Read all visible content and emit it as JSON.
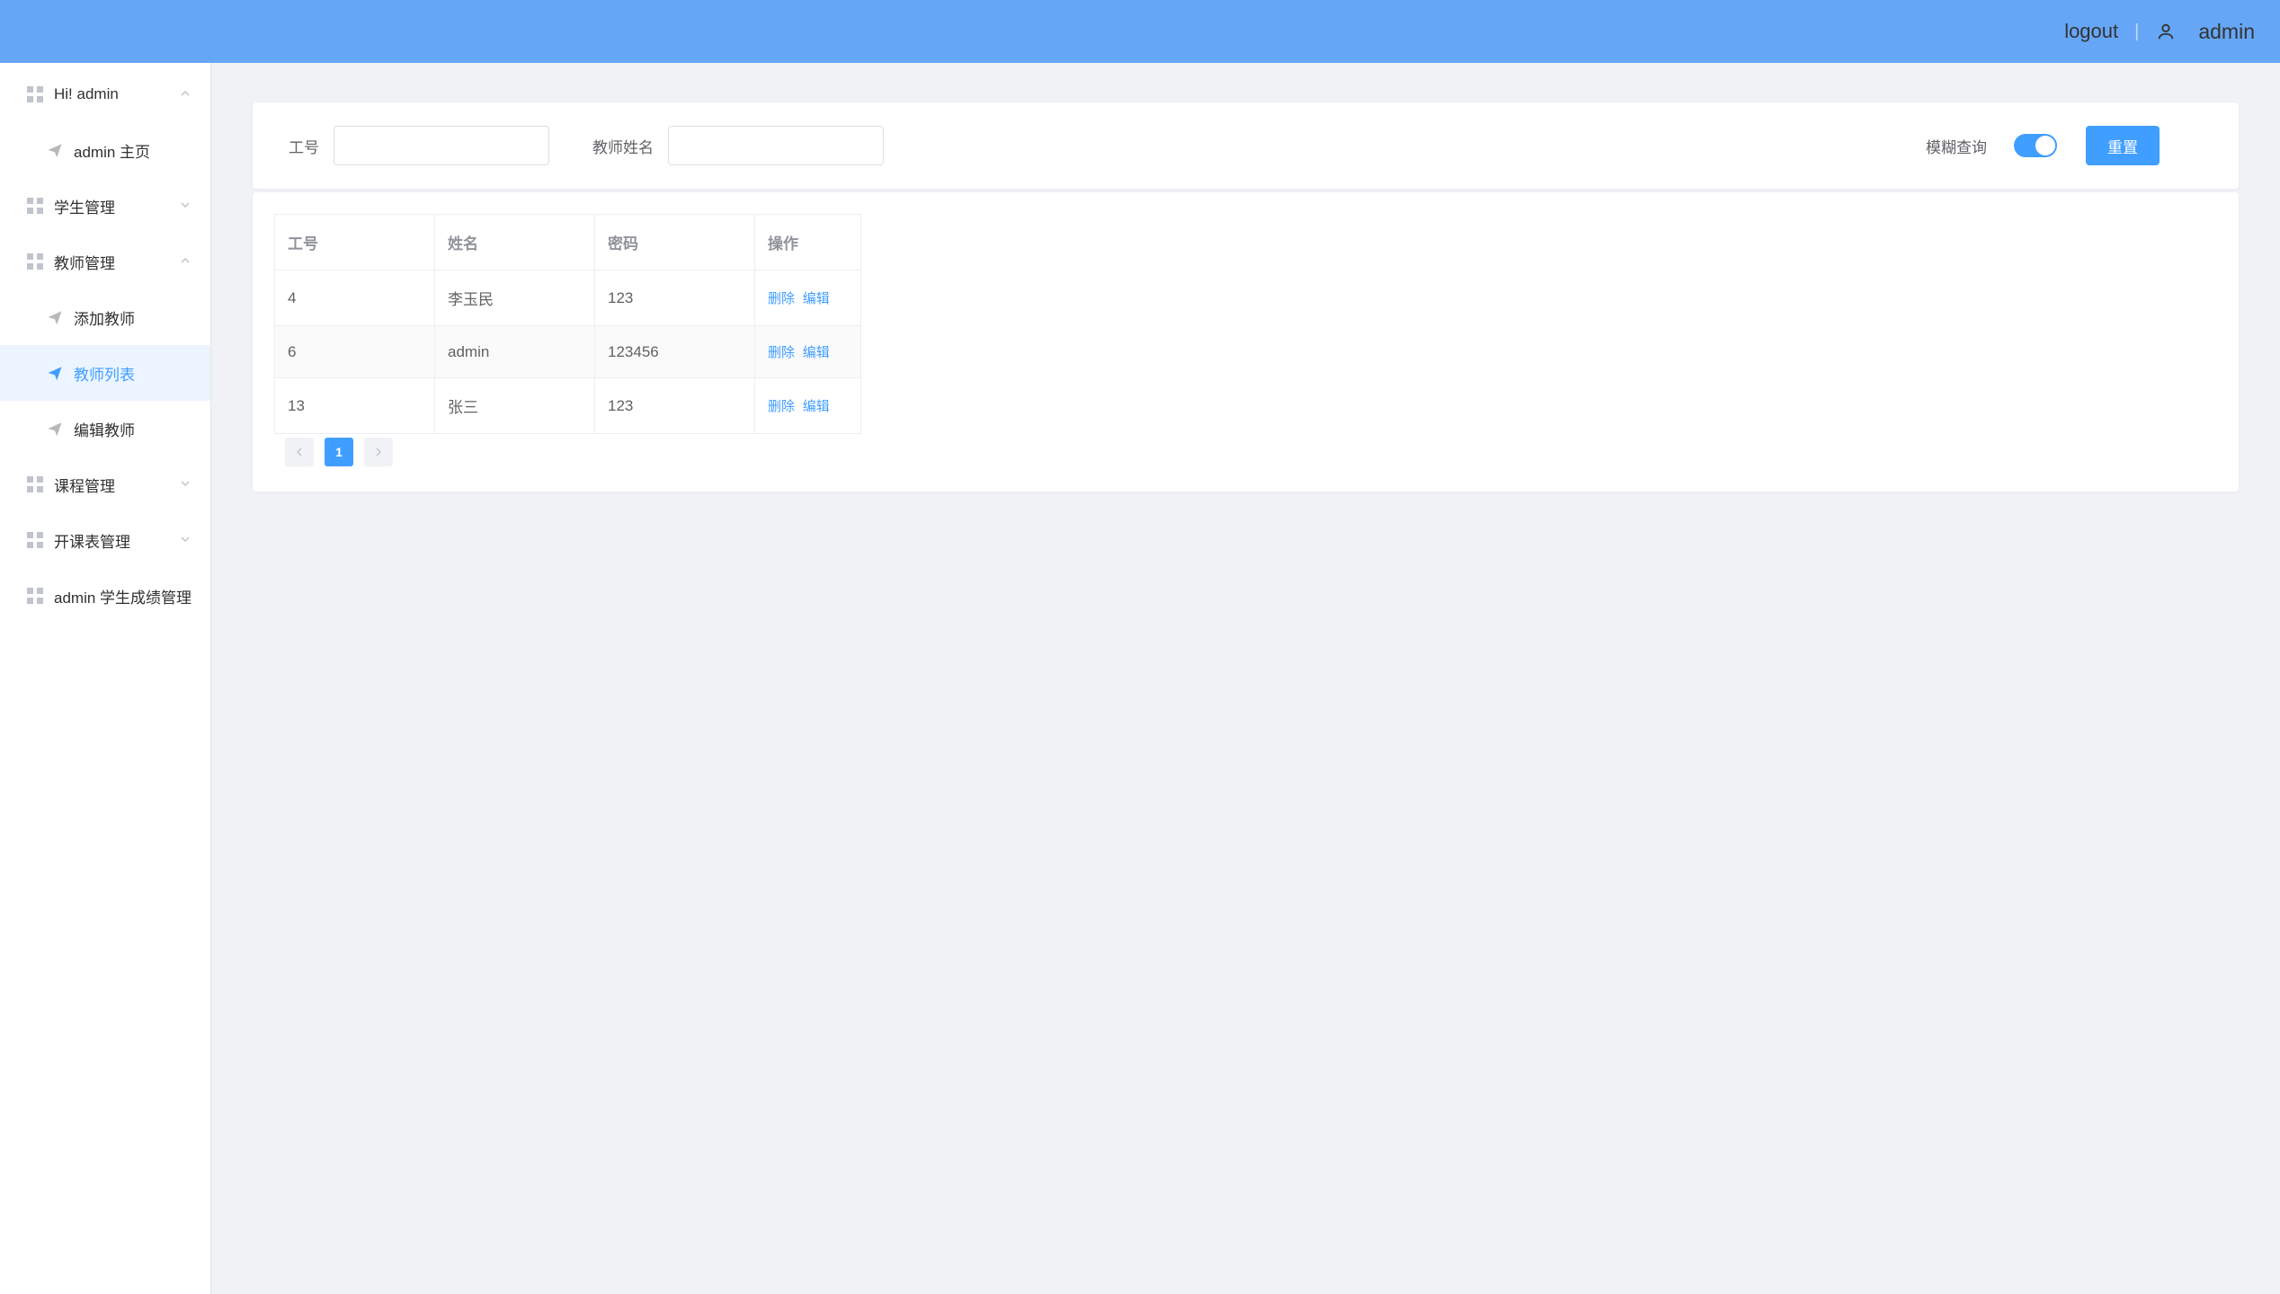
{
  "header": {
    "logout": "logout",
    "username": "admin"
  },
  "sidebar": {
    "items": [
      {
        "label": "Hi! admin",
        "icon": "grid",
        "expandable": true,
        "expanded": true
      },
      {
        "label": "admin 主页",
        "icon": "plane",
        "sub": true
      },
      {
        "label": "学生管理",
        "icon": "grid",
        "expandable": true,
        "expanded": false
      },
      {
        "label": "教师管理",
        "icon": "grid",
        "expandable": true,
        "expanded": true
      },
      {
        "label": "添加教师",
        "icon": "plane",
        "sub": true
      },
      {
        "label": "教师列表",
        "icon": "plane",
        "sub": true,
        "active": true
      },
      {
        "label": "编辑教师",
        "icon": "plane",
        "sub": true
      },
      {
        "label": "课程管理",
        "icon": "grid",
        "expandable": true,
        "expanded": false
      },
      {
        "label": "开课表管理",
        "icon": "grid",
        "expandable": true,
        "expanded": false
      },
      {
        "label": "admin 学生成绩管理",
        "icon": "grid",
        "expandable": false
      }
    ]
  },
  "filter": {
    "id_label": "工号",
    "id_value": "",
    "name_label": "教师姓名",
    "name_value": "",
    "fuzzy_label": "模糊查询",
    "fuzzy_on": true,
    "reset_label": "重置"
  },
  "table": {
    "columns": [
      "工号",
      "姓名",
      "密码",
      "操作"
    ],
    "rows": [
      {
        "id": "4",
        "name": "李玉民",
        "pwd": "123"
      },
      {
        "id": "6",
        "name": "admin",
        "pwd": "123456"
      },
      {
        "id": "13",
        "name": "张三",
        "pwd": "123"
      }
    ],
    "op_delete": "删除",
    "op_edit": "编辑"
  },
  "pager": {
    "current": "1"
  }
}
